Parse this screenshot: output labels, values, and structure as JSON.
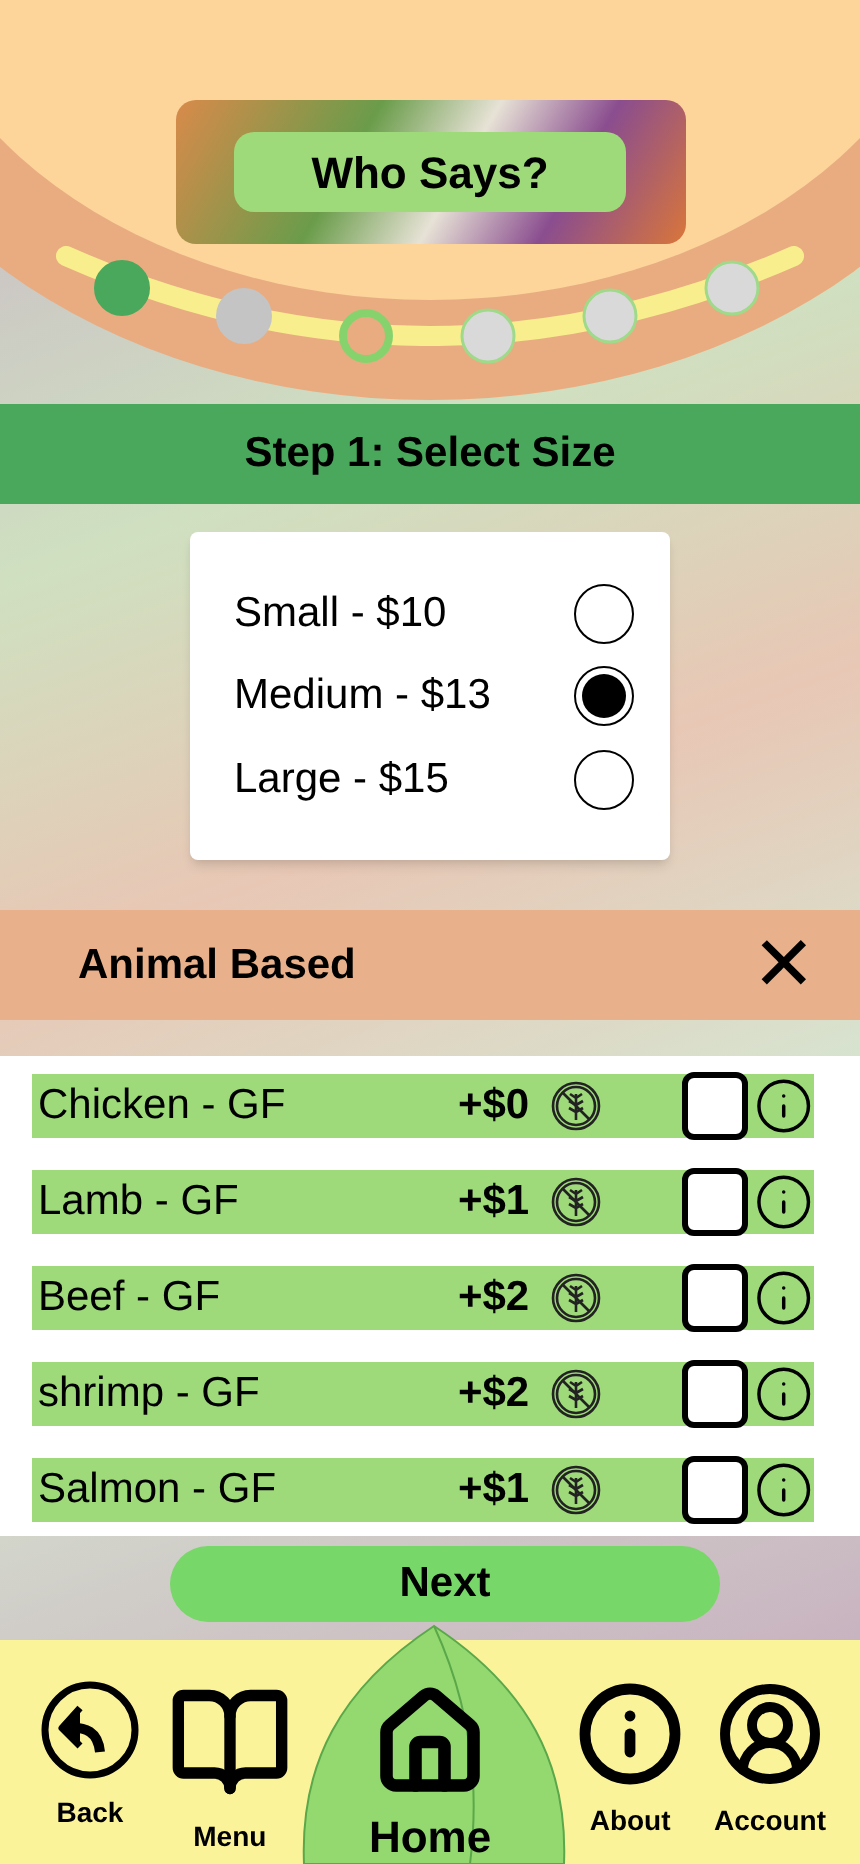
{
  "header": {
    "title": "Who Says?"
  },
  "progress_steps": [
    {
      "kind": "done"
    },
    {
      "kind": "visited"
    },
    {
      "kind": "current"
    },
    {
      "kind": "upcoming"
    },
    {
      "kind": "upcoming"
    },
    {
      "kind": "upcoming"
    }
  ],
  "step_banner": "Step 1: Select Size",
  "size_options": [
    {
      "label": "Small - $10",
      "selected": false
    },
    {
      "label": "Medium - $13",
      "selected": true
    },
    {
      "label": "Large - $15",
      "selected": false
    }
  ],
  "section": {
    "title": "Animal Based",
    "close": "✕"
  },
  "items": [
    {
      "name": "Chicken - GF",
      "price": "+$0",
      "checked": false
    },
    {
      "name": "Lamb - GF",
      "price": "+$1",
      "checked": false
    },
    {
      "name": "Beef - GF",
      "price": "+$2",
      "checked": false
    },
    {
      "name": "shrimp - GF",
      "price": "+$2",
      "checked": false
    },
    {
      "name": "Salmon - GF",
      "price": "+$1",
      "checked": false
    }
  ],
  "next_button": "Next",
  "nav": [
    {
      "label": "Back",
      "kind": "back",
      "selected": false
    },
    {
      "label": "Menu",
      "kind": "menu",
      "selected": false
    },
    {
      "label": "Home",
      "kind": "home",
      "selected": true
    },
    {
      "label": "About",
      "kind": "about",
      "selected": false
    },
    {
      "label": "Account",
      "kind": "account",
      "selected": false
    }
  ]
}
